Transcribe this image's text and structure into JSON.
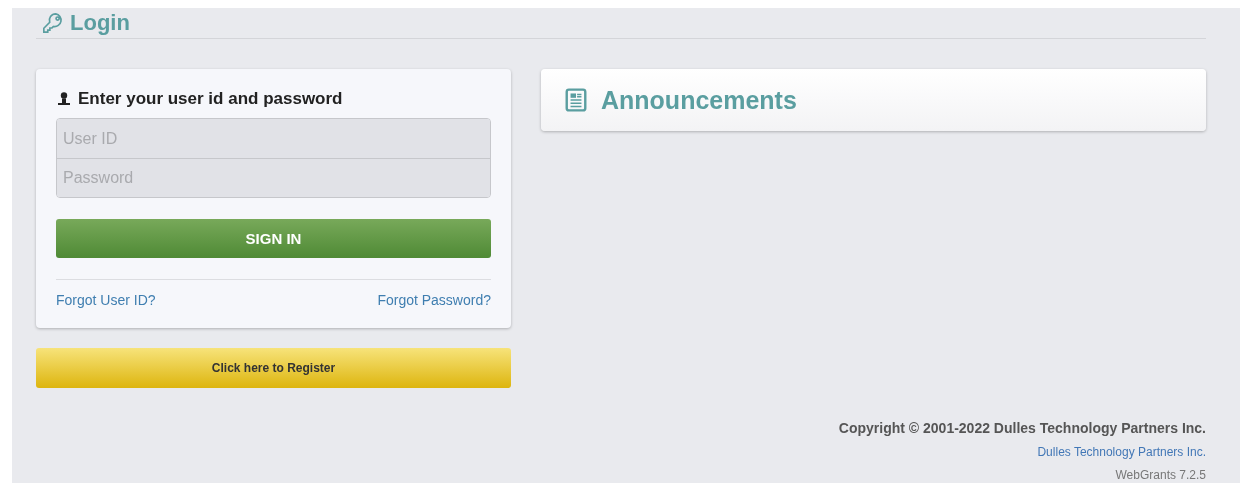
{
  "page_title": "Login",
  "login_box": {
    "heading": "Enter your user id and password",
    "user_id": {
      "placeholder": "User ID"
    },
    "password": {
      "placeholder": "Password"
    },
    "sign_in": "SIGN IN",
    "forgot_user_id": "Forgot User ID?",
    "forgot_password": "Forgot Password?"
  },
  "register_button": "Click here to Register",
  "announcements": {
    "title": "Announcements"
  },
  "footer": {
    "copyright": "Copyright © 2001-2022 Dulles Technology Partners Inc.",
    "company_link": "Dulles Technology Partners Inc.",
    "version": "WebGrants 7.2.5"
  }
}
